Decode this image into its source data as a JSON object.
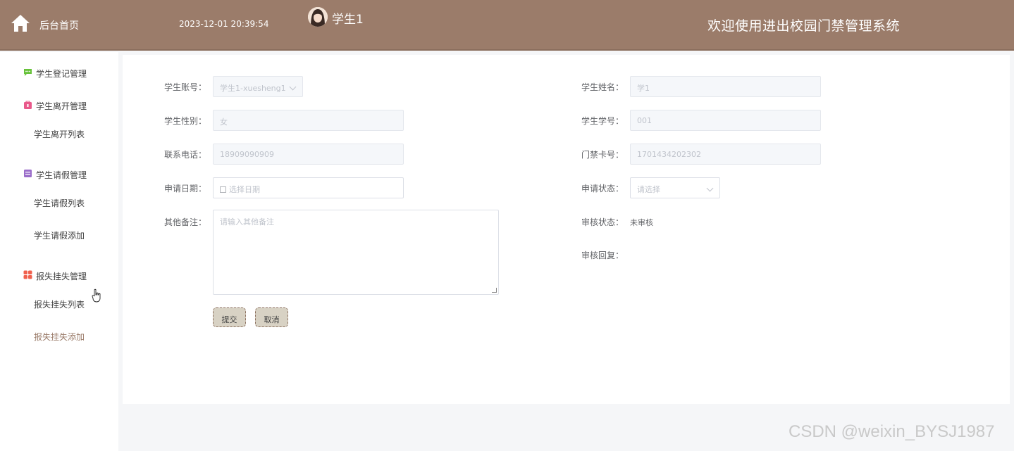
{
  "header": {
    "home_label": "后台首页",
    "datetime": "2023-12-01 20:39:54",
    "username": "学生1",
    "system_title": "欢迎使用进出校园门禁管理系统",
    "bg_color": "#9b7c6a"
  },
  "sidebar": {
    "items": [
      {
        "label": "学生登记管理",
        "icon": "chat-icon",
        "type": "group"
      },
      {
        "label": "学生离开管理",
        "icon": "bag-icon",
        "type": "group"
      },
      {
        "label": "学生离开列表",
        "type": "sub"
      },
      {
        "label": "学生请假管理",
        "icon": "box-icon",
        "type": "group"
      },
      {
        "label": "学生请假列表",
        "type": "sub"
      },
      {
        "label": "学生请假添加",
        "type": "sub"
      },
      {
        "label": "报失挂失管理",
        "icon": "grid-icon",
        "type": "group"
      },
      {
        "label": "报失挂失列表",
        "type": "sub"
      },
      {
        "label": "报失挂失添加",
        "type": "sub",
        "active": true
      }
    ]
  },
  "form": {
    "student_account": {
      "label": "学生账号：",
      "value": "学生1-xuesheng1"
    },
    "student_name": {
      "label": "学生姓名：",
      "value": "学1"
    },
    "student_gender": {
      "label": "学生性别：",
      "value": "女"
    },
    "student_number": {
      "label": "学生学号：",
      "value": "001"
    },
    "phone": {
      "label": "联系电话：",
      "value": "18909090909"
    },
    "card_number": {
      "label": "门禁卡号：",
      "value": "1701434202302"
    },
    "apply_date": {
      "label": "申请日期：",
      "placeholder": "选择日期"
    },
    "apply_status": {
      "label": "申请状态：",
      "placeholder": "请选择"
    },
    "remarks": {
      "label": "其他备注：",
      "placeholder": "请输入其他备注"
    },
    "review_status": {
      "label": "审核状态：",
      "value": "未审核"
    },
    "review_reply": {
      "label": "审核回复：",
      "value": ""
    },
    "submit_label": "提交",
    "cancel_label": "取消"
  },
  "watermark": "CSDN @weixin_BYSJ1987"
}
